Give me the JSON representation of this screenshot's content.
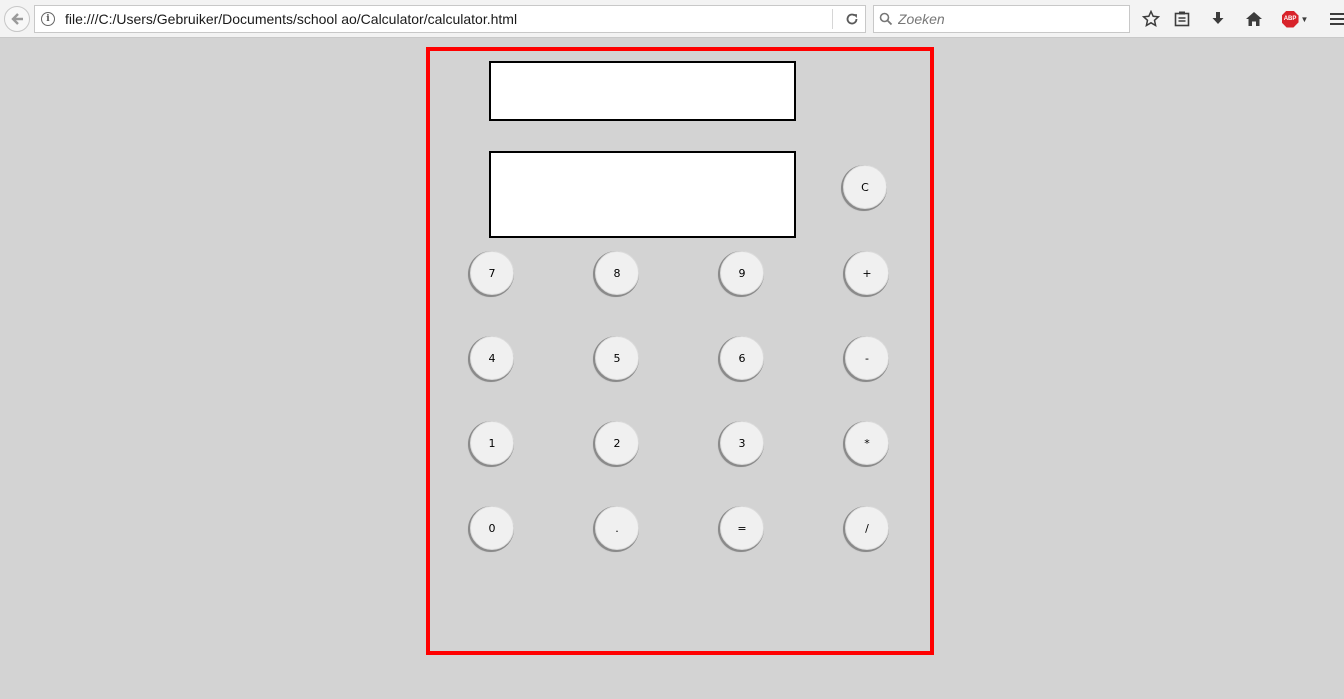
{
  "browser": {
    "url": "file:///C:/Users/Gebruiker/Documents/school ao/Calculator/calculator.html",
    "search_placeholder": "Zoeken",
    "abp_label": "ABP"
  },
  "calculator": {
    "display_top_value": "",
    "display_main_value": "",
    "clear_label": "C",
    "keys": {
      "k7": "7",
      "k8": "8",
      "k9": "9",
      "plus": "+",
      "k4": "4",
      "k5": "5",
      "k6": "6",
      "minus": "-",
      "k1": "1",
      "k2": "2",
      "k3": "3",
      "multiply": "*",
      "k0": "0",
      "dot": ".",
      "equals": "=",
      "divide": "/"
    },
    "border_color": "#ff0000"
  }
}
